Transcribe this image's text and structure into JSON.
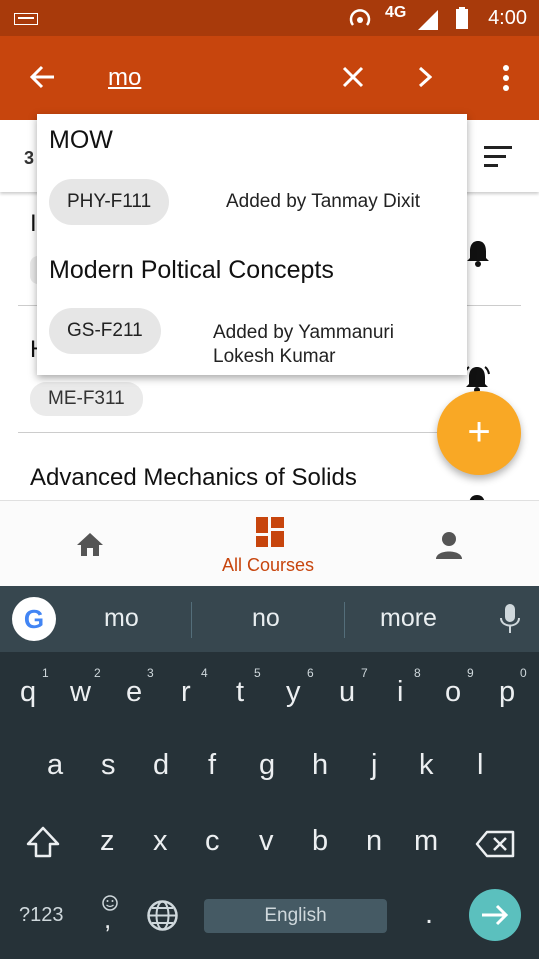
{
  "status_bar": {
    "network": "4G",
    "time": "4:00"
  },
  "toolbar": {
    "query": "mo"
  },
  "list": {
    "count_prefix": "3",
    "items": [
      {
        "title": "I",
        "chip": ""
      },
      {
        "title": "H",
        "chip": "ME-F311"
      },
      {
        "title": "Advanced Mechanics of Solids",
        "chip": ""
      }
    ]
  },
  "suggestions": [
    {
      "title": "MOW",
      "code": "PHY-F111",
      "added_by": "Added by Tanmay Dixit"
    },
    {
      "title": "Modern Poltical Concepts",
      "code": "GS-F211",
      "added_by": "Added by Yammanuri Lokesh Kumar"
    }
  ],
  "fab": {
    "label": "+"
  },
  "bottom_nav": {
    "active_label": "All Courses"
  },
  "keyboard": {
    "suggestions": [
      "mo",
      "no",
      "more"
    ],
    "row1": [
      {
        "k": "q",
        "h": "1"
      },
      {
        "k": "w",
        "h": "2"
      },
      {
        "k": "e",
        "h": "3"
      },
      {
        "k": "r",
        "h": "4"
      },
      {
        "k": "t",
        "h": "5"
      },
      {
        "k": "y",
        "h": "6"
      },
      {
        "k": "u",
        "h": "7"
      },
      {
        "k": "i",
        "h": "8"
      },
      {
        "k": "o",
        "h": "9"
      },
      {
        "k": "p",
        "h": "0"
      }
    ],
    "row2": [
      "a",
      "s",
      "d",
      "f",
      "g",
      "h",
      "j",
      "k",
      "l"
    ],
    "row3": [
      "z",
      "x",
      "c",
      "v",
      "b",
      "n",
      "m"
    ],
    "symbols_label": "?123",
    "comma_label": ",",
    "period_label": ".",
    "space_label": "English"
  }
}
